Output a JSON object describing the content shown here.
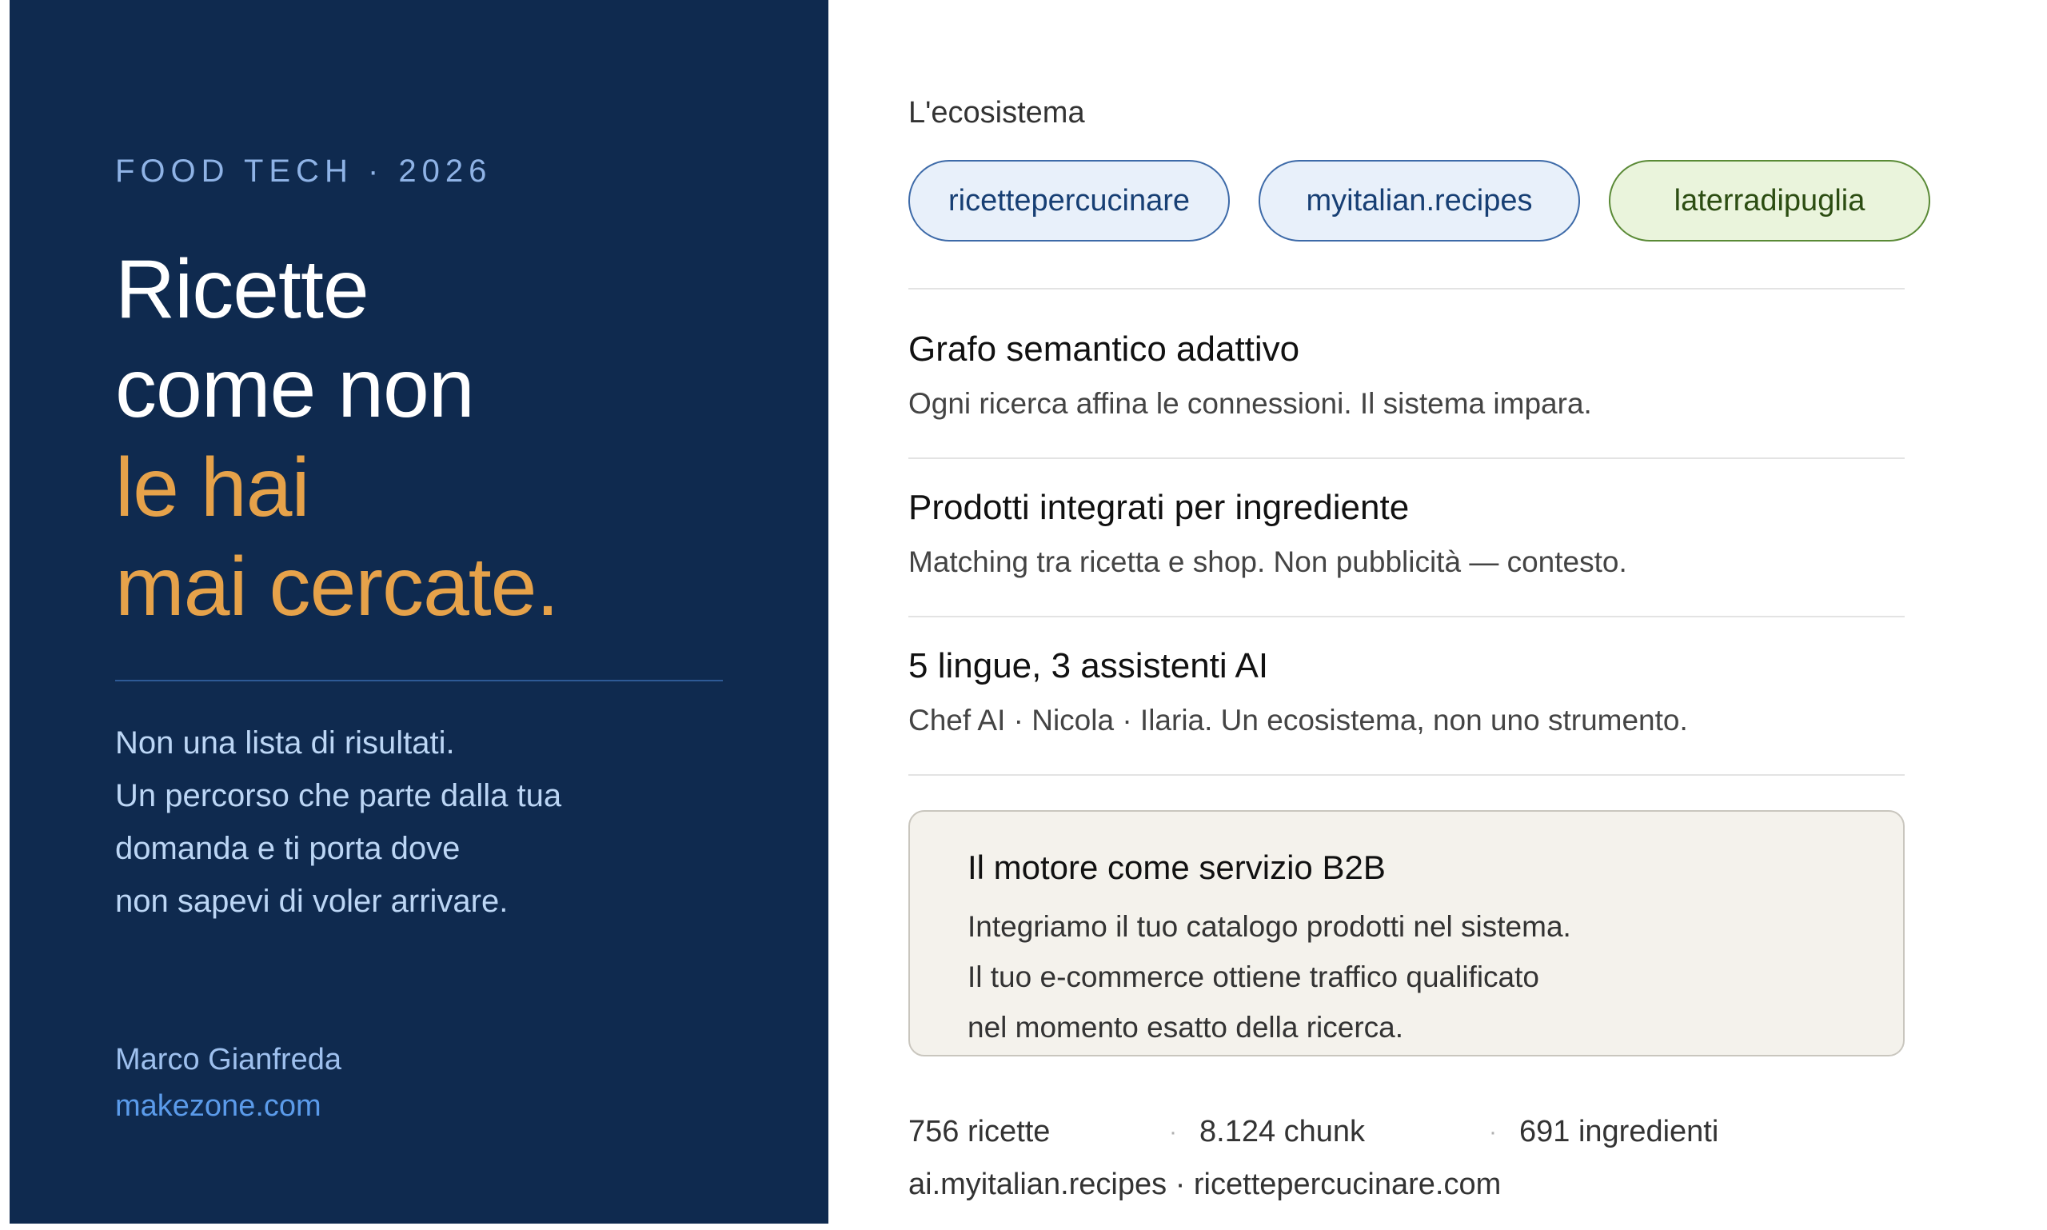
{
  "left": {
    "eyebrow": "FOOD TECH · 2026",
    "headline": {
      "line1": "Ricette",
      "line2": "come non",
      "line3": "le hai",
      "line4": "mai cercate."
    },
    "lead": {
      "line1": "Non una lista di risultati.",
      "line2": "Un percorso che parte dalla tua",
      "line3": "domanda e ti porta dove",
      "line4": "non sapevi di voler arrivare."
    },
    "author": "Marco Gianfreda",
    "site": "makezone.com"
  },
  "right": {
    "section_label": "L'ecosistema",
    "pills": [
      {
        "label": "ricettepercucinare",
        "color": "#3d6aa8"
      },
      {
        "label": "myitalian.recipes",
        "color": "#3d6aa8"
      },
      {
        "label": "laterradipuglia",
        "color": "#5a8a36"
      }
    ],
    "features": [
      {
        "title": "Grafo semantico adattivo",
        "desc": "Ogni ricerca affina le connessioni. Il sistema impara."
      },
      {
        "title": "Prodotti integrati per ingrediente",
        "desc": "Matching tra ricetta e shop. Non pubblicità — contesto."
      },
      {
        "title": "5 lingue, 3 assistenti AI",
        "desc": "Chef AI · Nicola · Ilaria. Un ecosistema, non uno strumento."
      }
    ],
    "b2b": {
      "title": "Il motore come servizio B2B",
      "line1": "Integriamo il tuo catalogo prodotti nel sistema.",
      "line2": "Il tuo e-commerce ottiene traffico qualificato",
      "line3": "nel momento esatto della ricerca."
    },
    "stats": {
      "recipes": "756 ricette",
      "chunks": "8.124 chunk",
      "ingredients": "691 ingredienti",
      "separator": "·"
    },
    "domains": "ai.myitalian.recipes · ricettepercucinare.com"
  },
  "colors": {
    "panel_bg": "#0f2a4f",
    "accent_orange": "#e6a24a",
    "link_blue": "#5b9bea"
  }
}
